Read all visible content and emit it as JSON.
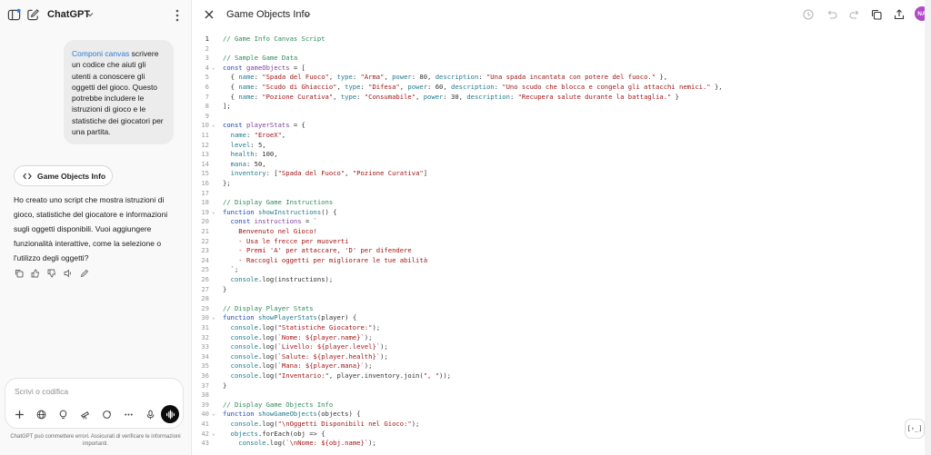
{
  "app": {
    "title": "ChatGPT"
  },
  "chat": {
    "user_message": {
      "highlight": "Componi canvas",
      "text": " scrivere un codice che aiuti gli utenti a conoscere gli oggetti del gioco. Questo potrebbe includere le istruzioni di gioco e le statistiche dei giocatori per una partita."
    },
    "canvas_chip_label": "Game Objects Info",
    "assistant_message": "Ho creato uno script che mostra istruzioni di gioco, statistiche del giocatore e informazioni sugli oggetti disponibili. Vuoi aggiungere funzionalità interattive, come la selezione o l'utilizzo degli oggetti?",
    "composer_placeholder": "Scrivi o codifica",
    "disclaimer": "ChatGPT può commettere errori. Assicurati di verificare le informazioni importanti."
  },
  "canvas": {
    "title": "Game Objects Info",
    "avatar_initials": "NA",
    "run_button_label": "[›_]",
    "code_lines": [
      [
        {
          "t": "// Game Info Canvas Script",
          "c": "#2e8b57"
        }
      ],
      [],
      [
        {
          "t": "// Sample Game Data",
          "c": "#2e8b57"
        }
      ],
      [
        {
          "t": "const ",
          "c": "#1a44b8"
        },
        {
          "t": "gameObjects",
          "c": "#7b3fa0"
        },
        {
          "t": " = [",
          "c": "#303030"
        }
      ],
      [
        {
          "t": "  { ",
          "c": "#303030"
        },
        {
          "t": "name",
          "c": "#1f7a8c"
        },
        {
          "t": ": ",
          "c": "#303030"
        },
        {
          "t": "\"Spada del Fuoco\"",
          "c": "#a31515"
        },
        {
          "t": ", ",
          "c": "#303030"
        },
        {
          "t": "type",
          "c": "#1f7a8c"
        },
        {
          "t": ": ",
          "c": "#303030"
        },
        {
          "t": "\"Arma\"",
          "c": "#a31515"
        },
        {
          "t": ", ",
          "c": "#303030"
        },
        {
          "t": "power",
          "c": "#1f7a8c"
        },
        {
          "t": ": 80, ",
          "c": "#303030"
        },
        {
          "t": "description",
          "c": "#1f7a8c"
        },
        {
          "t": ": ",
          "c": "#303030"
        },
        {
          "t": "\"Una spada incantata con potere del fuoco.\"",
          "c": "#a31515"
        },
        {
          "t": " },",
          "c": "#303030"
        }
      ],
      [
        {
          "t": "  { ",
          "c": "#303030"
        },
        {
          "t": "name",
          "c": "#1f7a8c"
        },
        {
          "t": ": ",
          "c": "#303030"
        },
        {
          "t": "\"Scudo di Ghiaccio\"",
          "c": "#a31515"
        },
        {
          "t": ", ",
          "c": "#303030"
        },
        {
          "t": "type",
          "c": "#1f7a8c"
        },
        {
          "t": ": ",
          "c": "#303030"
        },
        {
          "t": "\"Difesa\"",
          "c": "#a31515"
        },
        {
          "t": ", ",
          "c": "#303030"
        },
        {
          "t": "power",
          "c": "#1f7a8c"
        },
        {
          "t": ": 60, ",
          "c": "#303030"
        },
        {
          "t": "description",
          "c": "#1f7a8c"
        },
        {
          "t": ": ",
          "c": "#303030"
        },
        {
          "t": "\"Uno scudo che blocca e congela gli attacchi nemici.\"",
          "c": "#a31515"
        },
        {
          "t": " },",
          "c": "#303030"
        }
      ],
      [
        {
          "t": "  { ",
          "c": "#303030"
        },
        {
          "t": "name",
          "c": "#1f7a8c"
        },
        {
          "t": ": ",
          "c": "#303030"
        },
        {
          "t": "\"Pozione Curativa\"",
          "c": "#a31515"
        },
        {
          "t": ", ",
          "c": "#303030"
        },
        {
          "t": "type",
          "c": "#1f7a8c"
        },
        {
          "t": ": ",
          "c": "#303030"
        },
        {
          "t": "\"Consumabile\"",
          "c": "#a31515"
        },
        {
          "t": ", ",
          "c": "#303030"
        },
        {
          "t": "power",
          "c": "#1f7a8c"
        },
        {
          "t": ": 30, ",
          "c": "#303030"
        },
        {
          "t": "description",
          "c": "#1f7a8c"
        },
        {
          "t": ": ",
          "c": "#303030"
        },
        {
          "t": "\"Recupera salute durante la battaglia.\"",
          "c": "#a31515"
        },
        {
          "t": " }",
          "c": "#303030"
        }
      ],
      [
        {
          "t": "];",
          "c": "#303030"
        }
      ],
      [],
      [
        {
          "t": "const ",
          "c": "#1a44b8"
        },
        {
          "t": "playerStats",
          "c": "#7b3fa0"
        },
        {
          "t": " = {",
          "c": "#303030"
        }
      ],
      [
        {
          "t": "  name",
          "c": "#1f7a8c"
        },
        {
          "t": ": ",
          "c": "#303030"
        },
        {
          "t": "\"EroeX\"",
          "c": "#a31515"
        },
        {
          "t": ",",
          "c": "#303030"
        }
      ],
      [
        {
          "t": "  level",
          "c": "#1f7a8c"
        },
        {
          "t": ": 5,",
          "c": "#303030"
        }
      ],
      [
        {
          "t": "  health",
          "c": "#1f7a8c"
        },
        {
          "t": ": 100,",
          "c": "#303030"
        }
      ],
      [
        {
          "t": "  mana",
          "c": "#1f7a8c"
        },
        {
          "t": ": 50,",
          "c": "#303030"
        }
      ],
      [
        {
          "t": "  inventory",
          "c": "#1f7a8c"
        },
        {
          "t": ": [",
          "c": "#303030"
        },
        {
          "t": "\"Spada del Fuoco\"",
          "c": "#a31515"
        },
        {
          "t": ", ",
          "c": "#303030"
        },
        {
          "t": "\"Pozione Curativa\"",
          "c": "#a31515"
        },
        {
          "t": "]",
          "c": "#303030"
        }
      ],
      [
        {
          "t": "};",
          "c": "#303030"
        }
      ],
      [],
      [
        {
          "t": "// Display Game Instructions",
          "c": "#2e8b57"
        }
      ],
      [
        {
          "t": "function ",
          "c": "#1a44b8"
        },
        {
          "t": "showInstructions",
          "c": "#1f7a8c"
        },
        {
          "t": "() {",
          "c": "#303030"
        }
      ],
      [
        {
          "t": "  const ",
          "c": "#1a44b8"
        },
        {
          "t": "instructions",
          "c": "#7b3fa0"
        },
        {
          "t": " = `",
          "c": "#303030"
        }
      ],
      [
        {
          "t": "    Benvenuto nel Gioco!",
          "c": "#a31515"
        }
      ],
      [
        {
          "t": "    - Usa le frecce per muoverti",
          "c": "#a31515"
        }
      ],
      [
        {
          "t": "    - Premi 'A' per attaccare, 'D' per difendere",
          "c": "#a31515"
        }
      ],
      [
        {
          "t": "    - Raccogli oggetti per migliorare le tue abilità",
          "c": "#a31515"
        }
      ],
      [
        {
          "t": "  `;",
          "c": "#303030"
        }
      ],
      [
        {
          "t": "  console",
          "c": "#1f7a8c"
        },
        {
          "t": ".log(instructions);",
          "c": "#303030"
        }
      ],
      [
        {
          "t": "}",
          "c": "#303030"
        }
      ],
      [],
      [
        {
          "t": "// Display Player Stats",
          "c": "#2e8b57"
        }
      ],
      [
        {
          "t": "function ",
          "c": "#1a44b8"
        },
        {
          "t": "showPlayerStats",
          "c": "#1f7a8c"
        },
        {
          "t": "(player) {",
          "c": "#303030"
        }
      ],
      [
        {
          "t": "  console",
          "c": "#1f7a8c"
        },
        {
          "t": ".log(",
          "c": "#303030"
        },
        {
          "t": "\"Statistiche Giocatore:\"",
          "c": "#a31515"
        },
        {
          "t": ");",
          "c": "#303030"
        }
      ],
      [
        {
          "t": "  console",
          "c": "#1f7a8c"
        },
        {
          "t": ".log(",
          "c": "#303030"
        },
        {
          "t": "`Nome: ${player.name}`",
          "c": "#a31515"
        },
        {
          "t": ");",
          "c": "#303030"
        }
      ],
      [
        {
          "t": "  console",
          "c": "#1f7a8c"
        },
        {
          "t": ".log(",
          "c": "#303030"
        },
        {
          "t": "`Livello: ${player.level}`",
          "c": "#a31515"
        },
        {
          "t": ");",
          "c": "#303030"
        }
      ],
      [
        {
          "t": "  console",
          "c": "#1f7a8c"
        },
        {
          "t": ".log(",
          "c": "#303030"
        },
        {
          "t": "`Salute: ${player.health}`",
          "c": "#a31515"
        },
        {
          "t": ");",
          "c": "#303030"
        }
      ],
      [
        {
          "t": "  console",
          "c": "#1f7a8c"
        },
        {
          "t": ".log(",
          "c": "#303030"
        },
        {
          "t": "`Mana: ${player.mana}`",
          "c": "#a31515"
        },
        {
          "t": ");",
          "c": "#303030"
        }
      ],
      [
        {
          "t": "  console",
          "c": "#1f7a8c"
        },
        {
          "t": ".log(",
          "c": "#303030"
        },
        {
          "t": "\"Inventario:\"",
          "c": "#a31515"
        },
        {
          "t": ", player.inventory.join(",
          "c": "#303030"
        },
        {
          "t": "\", \"",
          "c": "#a31515"
        },
        {
          "t": "));",
          "c": "#303030"
        }
      ],
      [
        {
          "t": "}",
          "c": "#303030"
        }
      ],
      [],
      [
        {
          "t": "// Display Game Objects Info",
          "c": "#2e8b57"
        }
      ],
      [
        {
          "t": "function ",
          "c": "#1a44b8"
        },
        {
          "t": "showGameObjects",
          "c": "#1f7a8c"
        },
        {
          "t": "(objects) {",
          "c": "#303030"
        }
      ],
      [
        {
          "t": "  console",
          "c": "#1f7a8c"
        },
        {
          "t": ".log(",
          "c": "#303030"
        },
        {
          "t": "\"\\nOggetti Disponibili nel Gioco:\"",
          "c": "#a31515"
        },
        {
          "t": ");",
          "c": "#303030"
        }
      ],
      [
        {
          "t": "  objects",
          "c": "#1f7a8c"
        },
        {
          "t": ".forEach(obj => {",
          "c": "#303030"
        }
      ],
      [
        {
          "t": "    console",
          "c": "#1f7a8c"
        },
        {
          "t": ".log(",
          "c": "#303030"
        },
        {
          "t": "`\\nNome: ${obj.name}`",
          "c": "#a31515"
        },
        {
          "t": ");",
          "c": "#303030"
        }
      ]
    ],
    "fold_lines": [
      4,
      10,
      19,
      30,
      40,
      42
    ]
  }
}
